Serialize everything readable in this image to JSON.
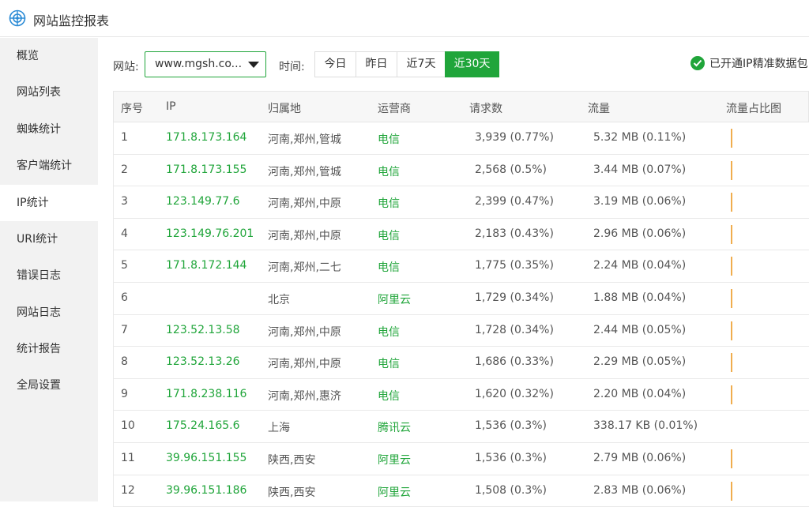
{
  "app": {
    "title": "网站监控报表",
    "logo_icon": "globe-target-icon"
  },
  "colors": {
    "accent": "#20a53a",
    "bar": "#f0ad4e",
    "sidebar_bg": "#f2f2f2"
  },
  "sidebar": {
    "items": [
      {
        "label": "概览",
        "active": false
      },
      {
        "label": "网站列表",
        "active": false
      },
      {
        "label": "蜘蛛统计",
        "active": false
      },
      {
        "label": "客户端统计",
        "active": false
      },
      {
        "label": "IP统计",
        "active": true
      },
      {
        "label": "URI统计",
        "active": false
      },
      {
        "label": "错误日志",
        "active": false
      },
      {
        "label": "网站日志",
        "active": false
      },
      {
        "label": "统计报告",
        "active": false
      },
      {
        "label": "全局设置",
        "active": false
      }
    ]
  },
  "toolbar": {
    "site_label": "网站:",
    "site_value": "www.mgsh.co...",
    "time_label": "时间:",
    "ranges": [
      {
        "label": "今日",
        "active": false
      },
      {
        "label": "昨日",
        "active": false
      },
      {
        "label": "近7天",
        "active": false
      },
      {
        "label": "近30天",
        "active": true
      }
    ],
    "ip_pack_text": "已开通IP精准数据包"
  },
  "table": {
    "headers": [
      "序号",
      "IP",
      "归属地",
      "运营商",
      "请求数",
      "流量",
      "流量占比图"
    ],
    "rows": [
      {
        "no": "1",
        "ip": "171.8.173.164",
        "loc": "河南,郑州,管城",
        "isp": "电信",
        "req": "3,939 (0.77%)",
        "traffic": "5.32 MB (0.11%)",
        "bar": true
      },
      {
        "no": "2",
        "ip": "171.8.173.155",
        "loc": "河南,郑州,管城",
        "isp": "电信",
        "req": "2,568 (0.5%)",
        "traffic": "3.44 MB (0.07%)",
        "bar": true
      },
      {
        "no": "3",
        "ip": "123.149.77.6",
        "loc": "河南,郑州,中原",
        "isp": "电信",
        "req": "2,399 (0.47%)",
        "traffic": "3.19 MB (0.06%)",
        "bar": true
      },
      {
        "no": "4",
        "ip": "123.149.76.201",
        "loc": "河南,郑州,中原",
        "isp": "电信",
        "req": "2,183 (0.43%)",
        "traffic": "2.96 MB (0.06%)",
        "bar": true
      },
      {
        "no": "5",
        "ip": "171.8.172.144",
        "loc": "河南,郑州,二七",
        "isp": "电信",
        "req": "1,775 (0.35%)",
        "traffic": "2.24 MB (0.04%)",
        "bar": true
      },
      {
        "no": "6",
        "ip": "",
        "loc": "北京",
        "isp": "阿里云",
        "req": "1,729 (0.34%)",
        "traffic": "1.88 MB (0.04%)",
        "bar": true
      },
      {
        "no": "7",
        "ip": "123.52.13.58",
        "loc": "河南,郑州,中原",
        "isp": "电信",
        "req": "1,728 (0.34%)",
        "traffic": "2.44 MB (0.05%)",
        "bar": true
      },
      {
        "no": "8",
        "ip": "123.52.13.26",
        "loc": "河南,郑州,中原",
        "isp": "电信",
        "req": "1,686 (0.33%)",
        "traffic": "2.29 MB (0.05%)",
        "bar": true
      },
      {
        "no": "9",
        "ip": "171.8.238.116",
        "loc": "河南,郑州,惠济",
        "isp": "电信",
        "req": "1,620 (0.32%)",
        "traffic": "2.20 MB (0.04%)",
        "bar": true
      },
      {
        "no": "10",
        "ip": "175.24.165.6",
        "loc": "上海",
        "isp": "腾讯云",
        "req": "1,536 (0.3%)",
        "traffic": "338.17 KB (0.01%)",
        "bar": false
      },
      {
        "no": "11",
        "ip": "39.96.151.155",
        "loc": "陕西,西安",
        "isp": "阿里云",
        "req": "1,536 (0.3%)",
        "traffic": "2.79 MB (0.06%)",
        "bar": true
      },
      {
        "no": "12",
        "ip": "39.96.151.186",
        "loc": "陕西,西安",
        "isp": "阿里云",
        "req": "1,508 (0.3%)",
        "traffic": "2.83 MB (0.06%)",
        "bar": true
      }
    ]
  }
}
